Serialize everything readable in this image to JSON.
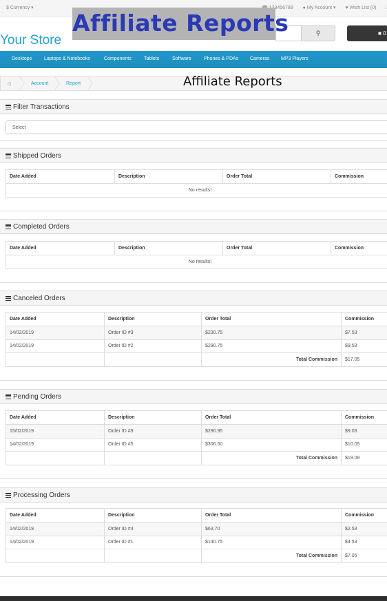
{
  "topbar": {
    "currency": "$ Currency ▾",
    "phone": "123456789",
    "account": "My Account ▾",
    "wishlist": "Wish List (0)",
    "cart_link": "Sh"
  },
  "banner": {
    "text": "Affiliate Reports"
  },
  "header": {
    "logo": "Your Store",
    "search_placeholder": "",
    "cart_label": "0"
  },
  "menu": [
    "Desktops",
    "Laptops & Notebooks",
    "Components",
    "Tablets",
    "Software",
    "Phones & PDAs",
    "Cameras",
    "MP3 Players"
  ],
  "breadcrumb": {
    "account": "Account",
    "report": "Report"
  },
  "page_title": "Affiliate Reports",
  "filter": {
    "title": "Filter Transactions",
    "select_value": "Select"
  },
  "columns": {
    "date": "Date Added",
    "desc": "Description",
    "total": "Order Total",
    "commission": "Commission"
  },
  "total_label": "Total Commission",
  "shipped": {
    "title": "Shipped Orders",
    "empty": "No results!"
  },
  "completed": {
    "title": "Completed Orders",
    "empty": "No results!"
  },
  "canceled": {
    "title": "Canceled Orders",
    "rows": [
      {
        "date": "14/02/2019",
        "desc": "Order ID #3",
        "total": "$230.75",
        "commission": "$7.53"
      },
      {
        "date": "14/02/2019",
        "desc": "Order ID #2",
        "total": "$290.75",
        "commission": "$9.53"
      }
    ],
    "total": "$17.05"
  },
  "pending": {
    "title": "Pending Orders",
    "rows": [
      {
        "date": "15/02/2019",
        "desc": "Order ID #9",
        "total": "$290.95",
        "commission": "$9.03"
      },
      {
        "date": "14/02/2019",
        "desc": "Order ID #5",
        "total": "$306.50",
        "commission": "$10.05"
      }
    ],
    "total": "$19.08"
  },
  "processing": {
    "title": "Processing Orders",
    "rows": [
      {
        "date": "14/02/2019",
        "desc": "Order ID #4",
        "total": "$63.70",
        "commission": "$2.53"
      },
      {
        "date": "14/02/2019",
        "desc": "Order ID #1",
        "total": "$140.75",
        "commission": "$4.53"
      }
    ],
    "total": "$7.05"
  },
  "colors": {
    "brand": "#23a1d1",
    "menu": "#229ac8",
    "banner_text": "#2a3ab5",
    "banner_bg": "#b4b4b4"
  }
}
